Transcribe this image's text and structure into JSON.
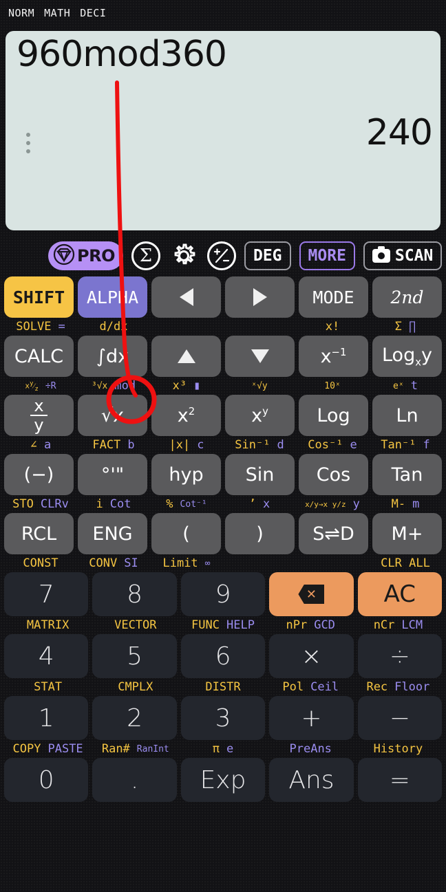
{
  "statusbar": {
    "items": [
      "NORM",
      "MATH",
      "DECI"
    ]
  },
  "display": {
    "expression": "960mod360",
    "result": "240",
    "overflow_icon": "vertical-dots-icon",
    "bg_color": "#d9e4e2"
  },
  "toolbar": {
    "menu_label": "hamburger-menu-icon",
    "pro_label": "PRO",
    "sigma_label": "Σ",
    "gear_label": "gear-icon",
    "plusminus_label": "plus-minus-icon",
    "deg_label": "DEG",
    "more_label": "MORE",
    "scan_label": "SCAN",
    "accent_purple": "#b690f5",
    "accent_yellow": "#f6c445"
  },
  "keypad": {
    "rows": [
      {
        "keys": [
          {
            "label": "SHIFT",
            "style": "shift"
          },
          {
            "label": "ALPHA",
            "style": "alpha"
          },
          {
            "label": "◀",
            "style": "fn",
            "icon": "arrow-left-icon"
          },
          {
            "label": "▶",
            "style": "fn",
            "icon": "arrow-right-icon"
          },
          {
            "label": "MODE",
            "style": "mode"
          },
          {
            "label": "2nd",
            "style": "second"
          }
        ],
        "hints_below": [
          {
            "y": "SOLVE",
            "p": "="
          },
          {
            "y": "d/dx",
            "p": ""
          },
          {
            "y": "",
            "p": ""
          },
          {
            "y": "",
            "p": ""
          },
          {
            "y": "x!",
            "p": ""
          },
          {
            "y": "Σ",
            "p": "∏"
          }
        ]
      },
      {
        "keys": [
          {
            "label": "CALC",
            "style": "fn"
          },
          {
            "label": "∫dx",
            "style": "fn"
          },
          {
            "label": "▲",
            "style": "fn",
            "icon": "arrow-up-icon"
          },
          {
            "label": "▼",
            "style": "fn",
            "icon": "arrow-down-icon"
          },
          {
            "label": "x⁻¹",
            "style": "fn"
          },
          {
            "label": "Logₓy",
            "style": "fn"
          }
        ],
        "hints_below": [
          {
            "y": "x y/z",
            "p": "÷R"
          },
          {
            "y": "³√x",
            "p": "mod"
          },
          {
            "y": "x³",
            "p": "▮"
          },
          {
            "y": "ˣ√y",
            "p": ""
          },
          {
            "y": "10ˣ",
            "p": ""
          },
          {
            "y": "eˣ",
            "p": "t"
          }
        ]
      },
      {
        "keys": [
          {
            "label": "x/y",
            "style": "fn"
          },
          {
            "label": "√x",
            "style": "fn"
          },
          {
            "label": "x²",
            "style": "fn"
          },
          {
            "label": "xʸ",
            "style": "fn"
          },
          {
            "label": "Log",
            "style": "fn"
          },
          {
            "label": "Ln",
            "style": "fn"
          }
        ],
        "hints_below": [
          {
            "y": "∠",
            "p": "a"
          },
          {
            "y": "FACT",
            "p": "b"
          },
          {
            "y": "|x|",
            "p": "c"
          },
          {
            "y": "Sin⁻¹",
            "p": "d"
          },
          {
            "y": "Cos⁻¹",
            "p": "e"
          },
          {
            "y": "Tan⁻¹",
            "p": "f"
          }
        ]
      },
      {
        "keys": [
          {
            "label": "(−)",
            "style": "fn"
          },
          {
            "label": "°'\"",
            "style": "fn"
          },
          {
            "label": "hyp",
            "style": "fn"
          },
          {
            "label": "Sin",
            "style": "fn"
          },
          {
            "label": "Cos",
            "style": "fn"
          },
          {
            "label": "Tan",
            "style": "fn"
          }
        ],
        "hints_below": [
          {
            "y": "STO",
            "p": "CLRv"
          },
          {
            "y": "i",
            "p": "Cot"
          },
          {
            "y": "%",
            "p": "Cot⁻¹"
          },
          {
            "y": "’",
            "p": "x"
          },
          {
            "y": "x/y→x y/z",
            "p": "y"
          },
          {
            "y": "M-",
            "p": "m"
          }
        ]
      },
      {
        "keys": [
          {
            "label": "RCL",
            "style": "fn"
          },
          {
            "label": "ENG",
            "style": "fn"
          },
          {
            "label": "(",
            "style": "fn"
          },
          {
            "label": ")",
            "style": "fn"
          },
          {
            "label": "S⇌D",
            "style": "fn"
          },
          {
            "label": "M+",
            "style": "fn"
          }
        ],
        "hints_below": [
          {
            "y": "CONST",
            "p": ""
          },
          {
            "y": "CONV",
            "p": "SI"
          },
          {
            "y": "Limit",
            "p": "∞"
          },
          {
            "y": "",
            "p": ""
          },
          {
            "y": "",
            "p": ""
          },
          {
            "y": "CLR ALL",
            "p": ""
          }
        ]
      },
      {
        "keys": [
          {
            "label": "7",
            "style": "num"
          },
          {
            "label": "8",
            "style": "num"
          },
          {
            "label": "9",
            "style": "num"
          },
          {
            "label": "DEL",
            "style": "orange",
            "icon": "backspace-icon"
          },
          {
            "label": "AC",
            "style": "orange"
          }
        ],
        "hints_below": [
          {
            "y": "MATRIX",
            "p": ""
          },
          {
            "y": "VECTOR",
            "p": ""
          },
          {
            "y": "FUNC",
            "p": "HELP"
          },
          {
            "y": "nPr",
            "p": "GCD"
          },
          {
            "y": "nCr",
            "p": "LCM"
          }
        ]
      },
      {
        "keys": [
          {
            "label": "4",
            "style": "num"
          },
          {
            "label": "5",
            "style": "num"
          },
          {
            "label": "6",
            "style": "num"
          },
          {
            "label": "×",
            "style": "num"
          },
          {
            "label": "÷",
            "style": "num"
          }
        ],
        "hints_below": [
          {
            "y": "STAT",
            "p": ""
          },
          {
            "y": "CMPLX",
            "p": ""
          },
          {
            "y": "DISTR",
            "p": ""
          },
          {
            "y": "Pol",
            "p": "Ceil"
          },
          {
            "y": "Rec",
            "p": "Floor"
          }
        ]
      },
      {
        "keys": [
          {
            "label": "1",
            "style": "num"
          },
          {
            "label": "2",
            "style": "num"
          },
          {
            "label": "3",
            "style": "num"
          },
          {
            "label": "+",
            "style": "num"
          },
          {
            "label": "−",
            "style": "num"
          }
        ],
        "hints_below": [
          {
            "y": "COPY",
            "p": "PASTE"
          },
          {
            "y": "Ran#",
            "p": "RanInt"
          },
          {
            "y": "π",
            "p": "e"
          },
          {
            "y": "",
            "p": "PreAns"
          },
          {
            "y": "History",
            "p": ""
          }
        ]
      },
      {
        "keys": [
          {
            "label": "0",
            "style": "num"
          },
          {
            "label": ".",
            "style": "num"
          },
          {
            "label": "Exp",
            "style": "num"
          },
          {
            "label": "Ans",
            "style": "num"
          },
          {
            "label": "=",
            "style": "num"
          }
        ],
        "hints_below": []
      }
    ]
  },
  "annotation": {
    "color": "#ee1111",
    "shape": "line-and-circle",
    "target": "mod"
  }
}
